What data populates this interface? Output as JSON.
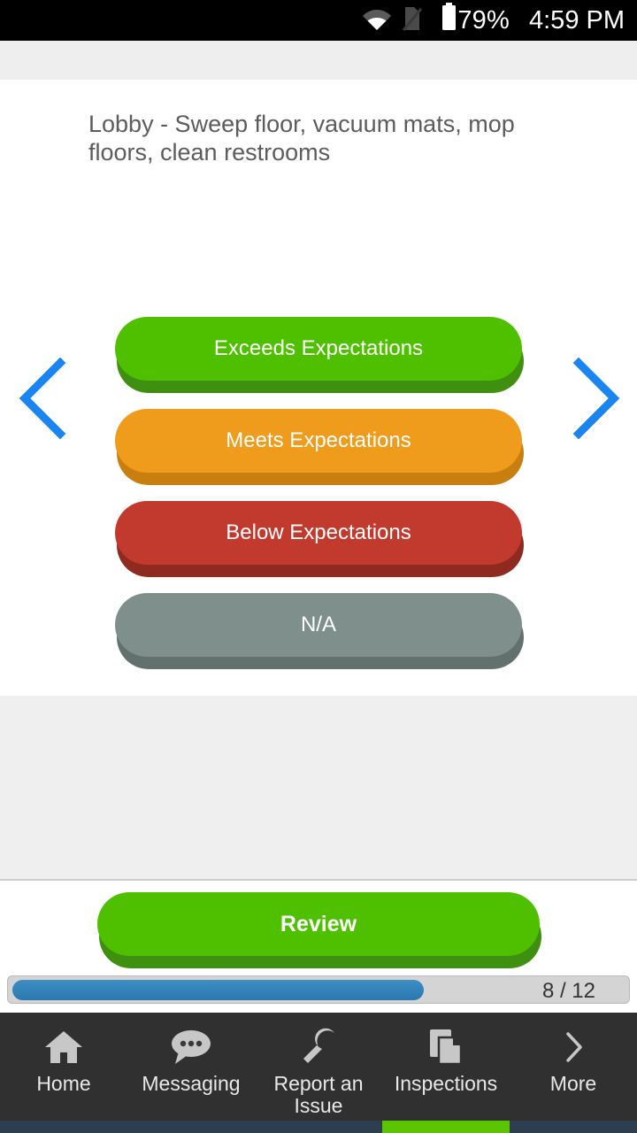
{
  "statusbar": {
    "wifi_icon": "wifi-icon",
    "sim_icon": "no-sim-icon",
    "battery_icon": "battery-icon",
    "battery_percent": "79%",
    "time": "4:59 PM"
  },
  "task": {
    "text": "Lobby - Sweep floor, vacuum mats, mop floors, clean restrooms"
  },
  "navigation": {
    "prev_icon": "chevron-left-icon",
    "next_icon": "chevron-right-icon",
    "arrow_color": "#1a85f0"
  },
  "options": [
    {
      "label": "Exceeds Expectations",
      "color": "#4fc000",
      "shadow": "#3f8f10",
      "variant": "opt-green"
    },
    {
      "label": "Meets Expectations",
      "color": "#ef9b1b",
      "shadow": "#c97f10",
      "variant": "opt-orange"
    },
    {
      "label": "Below Expectations",
      "color": "#c23a2e",
      "shadow": "#8f2a20",
      "variant": "opt-red"
    },
    {
      "label": "N/A",
      "color": "#7e8f8c",
      "shadow": "#62716e",
      "variant": "opt-gray"
    }
  ],
  "review": {
    "label": "Review",
    "color": "#4fc000"
  },
  "progress": {
    "current": 8,
    "total": 12,
    "label": "8 / 12",
    "percent": 67,
    "fill_color": "#2f82ba",
    "track_color": "#d4d4d4"
  },
  "bottomnav": {
    "items": [
      {
        "label": "Home",
        "icon": "home-icon"
      },
      {
        "label": "Messaging",
        "icon": "chat-bubble-icon"
      },
      {
        "label": "Report an Issue",
        "icon": "wrench-icon"
      },
      {
        "label": "Inspections",
        "icon": "documents-icon"
      },
      {
        "label": "More",
        "icon": "chevron-right-icon"
      }
    ]
  }
}
